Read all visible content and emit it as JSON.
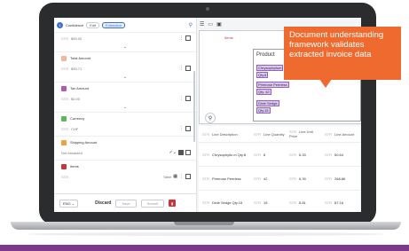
{
  "left_panel": {
    "step_number": "1",
    "header_label": "Confidence",
    "pills": [
      "Edit",
      "Extraction"
    ],
    "fields": [
      {
        "name": "",
        "value": "$90.00",
        "color": ""
      },
      {
        "name": "Total Amount",
        "value": "$90.71",
        "color": "#f2b5a0"
      },
      {
        "name": "Tax Amount",
        "value": "$0.00",
        "color": "#b05ab5"
      },
      {
        "name": "Currency",
        "value": "CHF",
        "color": "#5cb85c"
      },
      {
        "name": "Shipping Amount",
        "value": "Not extracted",
        "color": "#f0a040"
      },
      {
        "name": "Items",
        "value": "",
        "color": "#c7373a"
      }
    ],
    "table_label": "Table",
    "footer": {
      "language": "ENG",
      "discard": "Discard",
      "save": "Save",
      "submit": "Submit"
    }
  },
  "document": {
    "name": "Items",
    "header": "Product",
    "lines": [
      {
        "name": "Chrysophyllum",
        "tag": "Qty.8"
      },
      {
        "name": "Primrose Peerless",
        "tag": "Qty. 42"
      },
      {
        "name": "Dixie Sedge",
        "tag": "Qty.15"
      }
    ]
  },
  "table": {
    "headers": [
      "Line Description",
      "Line Quantity",
      "Line Unit Price",
      "Line Amount"
    ],
    "tag": "STR",
    "rows": [
      [
        "Chrysophyllu m Qty.8",
        "8",
        "6.33",
        "50.64"
      ],
      [
        "Primrose Peerless",
        "42",
        "6.39",
        "268.86"
      ],
      [
        "Dixie Sedge Qty.15",
        "15",
        "5.81",
        "87.16"
      ]
    ]
  },
  "callout": {
    "text": "Document understanding framework validates extracted invoice data",
    "color": "#ee6a2e"
  },
  "accent": "#3d6fd1"
}
